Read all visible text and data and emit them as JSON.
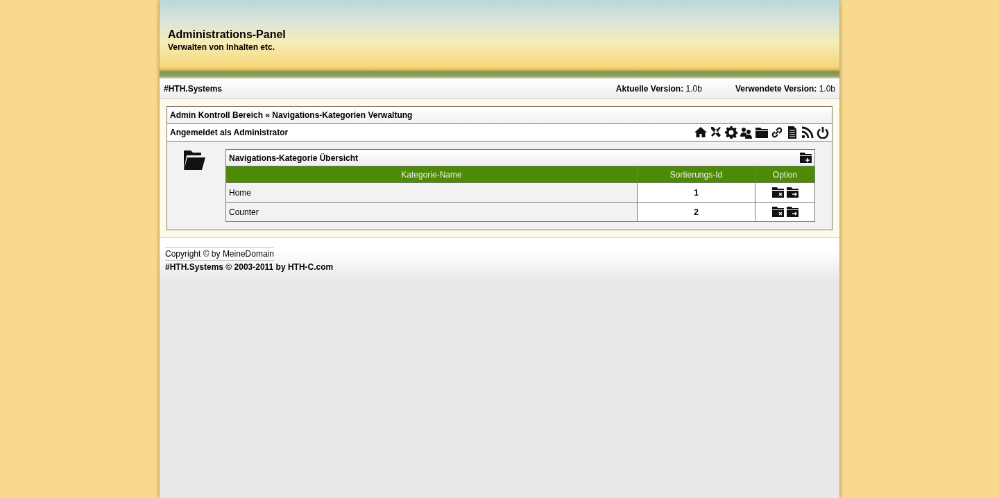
{
  "header": {
    "title": "Administrations-Panel",
    "subtitle": "Verwalten von Inhalten etc."
  },
  "top_bar": {
    "brand": "#HTH.Systems",
    "versions": [
      {
        "label": "Aktuelle Version:",
        "value": "1.0b"
      },
      {
        "label": "Verwendete Version:",
        "value": "1.0b"
      }
    ]
  },
  "breadcrumb": "Admin Kontroll Bereich » Navigations-Kategorien Verwaltung",
  "login_status": "Angemeldet als Administrator",
  "table": {
    "title": "Navigations-Kategorie Übersicht",
    "columns": [
      "Kategorie-Name",
      "Sortierungs-Id",
      "Option"
    ],
    "rows": [
      {
        "name": "Home",
        "sort_id": "1"
      },
      {
        "name": "Counter",
        "sort_id": "2"
      }
    ]
  },
  "footer": {
    "copyright": "Copyright © by MeineDomain",
    "credit": "#HTH.Systems © 2003-2011 by HTH-C.com"
  }
}
